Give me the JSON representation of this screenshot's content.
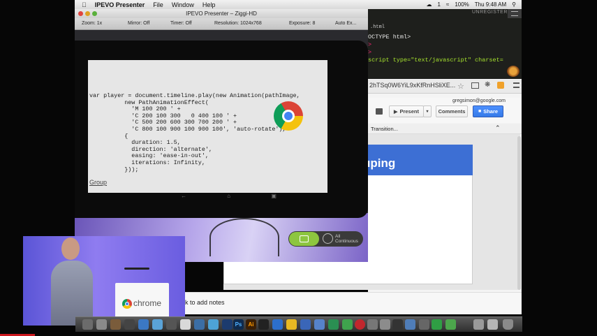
{
  "menubar": {
    "app_name": "IPEVO Presenter",
    "items": [
      "File",
      "Window",
      "Help"
    ],
    "badge": "1",
    "battery": "100%",
    "clock": "Thu 9:48 AM"
  },
  "editor": {
    "unregistered": "UNREGISTERED",
    "tab": ".html",
    "lines": [
      "OCTYPE html>",
      ">",
      ">",
      "script type=\"text/javascript\" charset="
    ]
  },
  "browser": {
    "url": "2hTSq0W6YiL9xKfRnHSliXE..."
  },
  "slides": {
    "account": "gregsimon@google.com",
    "present_label": "Present",
    "comments_label": "Comments",
    "share_label": "Share",
    "transition_label": "Transition...",
    "slide_title": "uping",
    "notes_placeholder": "k to add notes"
  },
  "ipevo": {
    "window_title": "IPEVO Presenter – Ziggi-HD",
    "toolbar": {
      "zoom": "Zoom: 1x",
      "mirror": "Mirror: Off",
      "timer": "Timer: Off",
      "resolution": "Resolution: 1024x768",
      "exposure": "Exposure: 8",
      "auto": "Auto Ex..."
    },
    "code": "var player = document.timeline.play(new Animation(pathImage,\n          new PathAnimationEffect(\n            'M 100 200 ' +\n            'C 200 100 300   0 400 100 ' +\n            'C 500 200 600 300 700 200 ' +\n            'C 800 100 900 100 900 100', 'auto-rotate'),\n          {\n            duration: 1.5,\n            direction: 'alternate',\n            easing: 'ease-in-out',\n            iterations: Infinity,\n          }));",
    "group_link": "Group",
    "capture_mode": [
      "All",
      "Continuous"
    ]
  },
  "presenter": {
    "podium_label": "chrome"
  },
  "dock": {
    "items": [
      "Ps",
      "Ai"
    ]
  },
  "colors": {
    "slides_blue": "#3d6fd4",
    "share_blue": "#4d90fe",
    "capture_green": "#8dc63f",
    "progress_red": "#cc181e"
  }
}
